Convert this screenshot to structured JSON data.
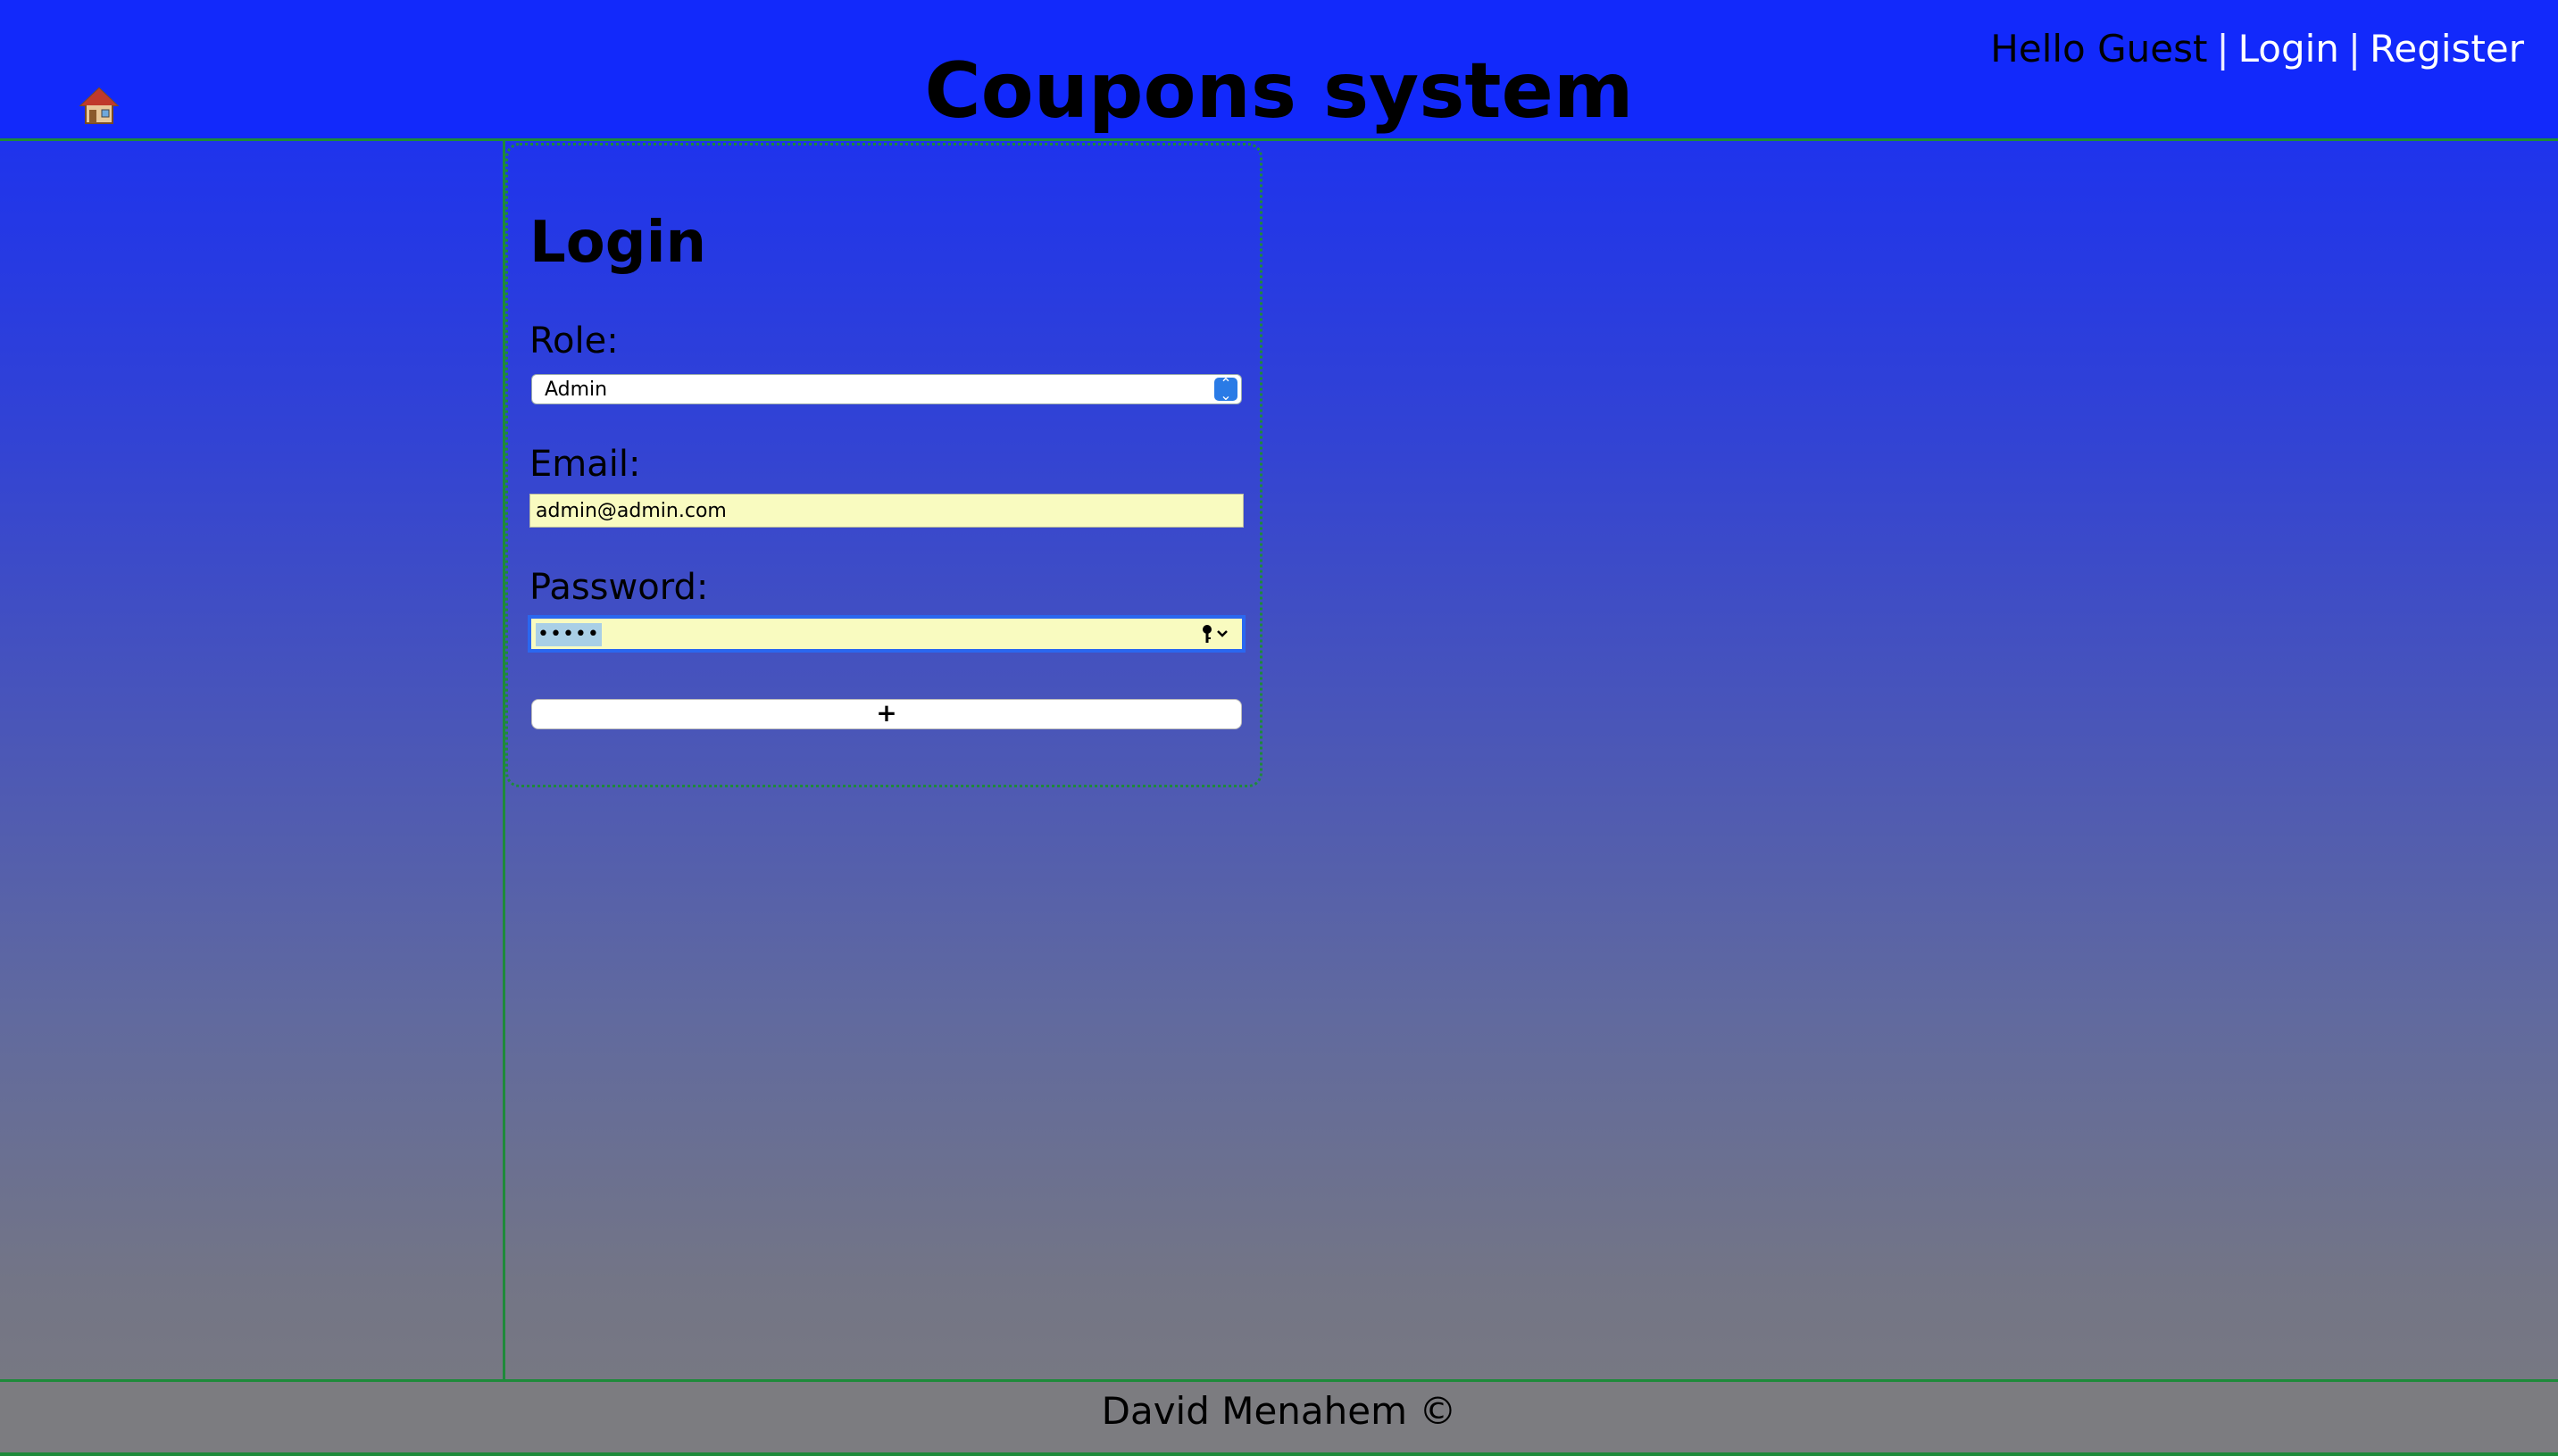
{
  "header": {
    "title": "Coupons system",
    "greeting": "Hello Guest",
    "separator": "|",
    "login_link": "Login",
    "register_link": "Register",
    "home_icon": "house-icon"
  },
  "login_form": {
    "title": "Login",
    "role_label": "Role:",
    "role_value": "Admin",
    "email_label": "Email:",
    "email_value": "admin@admin.com",
    "password_label": "Password:",
    "password_value": "•••••",
    "submit_label": "+"
  },
  "footer": {
    "text": "David Menahem ©"
  },
  "colors": {
    "header_bg": "#1229fb",
    "border_green": "#1e8a3a",
    "input_autofill": "#f9fbc0",
    "focus_blue": "#2a67f0"
  }
}
